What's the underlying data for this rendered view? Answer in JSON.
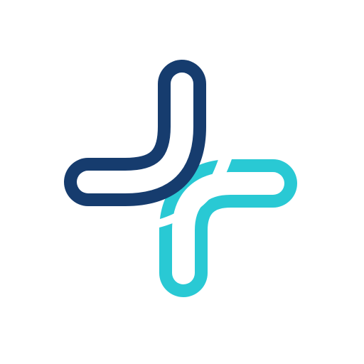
{
  "logo": {
    "icon": "medical-cross-logo-icon",
    "colors": {
      "navy": "#163c6e",
      "teal": "#29c9d4",
      "background": "#ffffff"
    }
  }
}
